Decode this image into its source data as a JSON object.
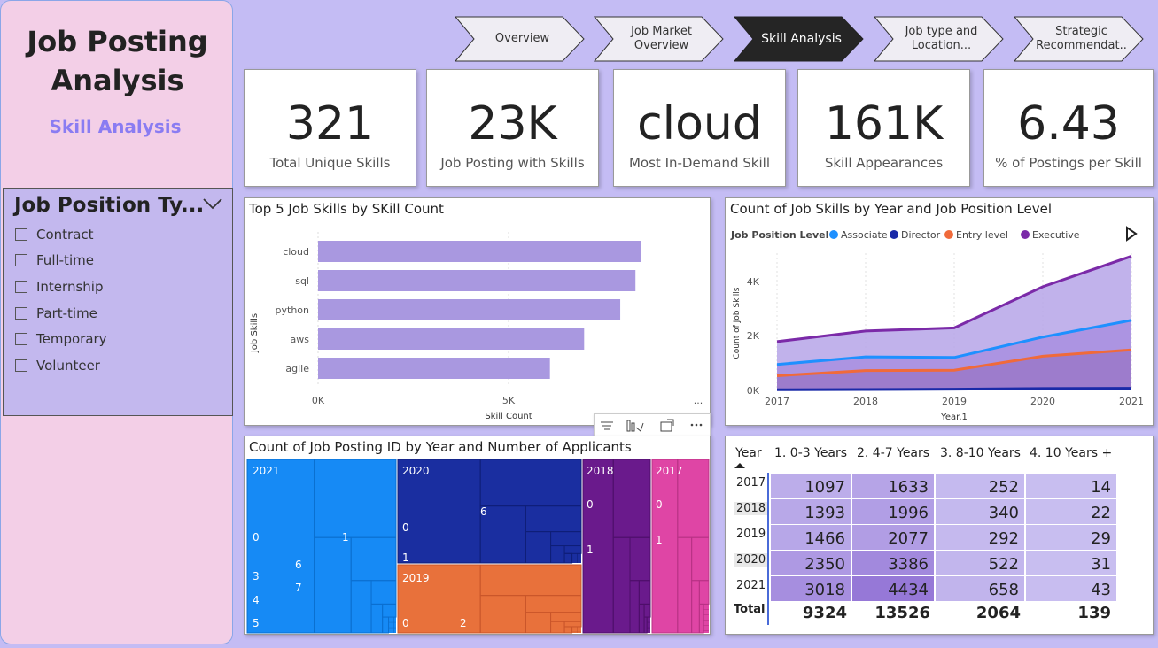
{
  "sidebar": {
    "title": "Job Posting Analysis",
    "subtitle": "Skill Analysis"
  },
  "slicer": {
    "title": "Job Position Ty...",
    "items": [
      "Contract",
      "Full-time",
      "Internship",
      "Part-time",
      "Temporary",
      "Volunteer"
    ]
  },
  "nav": {
    "tabs": [
      {
        "label": "Overview"
      },
      {
        "label": "Job Market Overview"
      },
      {
        "label": "Skill Analysis"
      },
      {
        "label": "Job type and Location..."
      },
      {
        "label": "Strategic Recommendat.."
      }
    ],
    "active": "Skill Analysis"
  },
  "kpis": [
    {
      "value": "321",
      "label": "Total Unique Skills"
    },
    {
      "value": "23K",
      "label": "Job Posting with Skills"
    },
    {
      "value": "cloud",
      "label": "Most In-Demand Skill"
    },
    {
      "value": "161K",
      "label": "Skill Appearances"
    },
    {
      "value": "6.43",
      "label": "% of Postings per Skill"
    }
  ],
  "bar_chart": {
    "title": "Top 5 Job Skills by SKill Count",
    "xlabel": "Skill Count",
    "ylabel": "Job Skills",
    "xticks": [
      "0K",
      "5K"
    ],
    "more": "..."
  },
  "area_chart": {
    "title": "Count of Job Skills by Year and Job Position Level",
    "legend_title": "Job Position Level",
    "xlabel": "Year.1",
    "ylabel": "Count of Job Skills",
    "yticks": [
      "0K",
      "2K",
      "4K"
    ]
  },
  "treemap": {
    "title": "Count of Job Posting ID by Year and Number of Applicants",
    "labels": {
      "y2021": "2021",
      "y2020": "2020",
      "y2019": "2019",
      "y2018": "2018",
      "y2017": "2017",
      "a0": "0",
      "a1": "1",
      "a2": "2",
      "a3": "3",
      "a4": "4",
      "a5": "5",
      "a6": "6",
      "a7": "7"
    }
  },
  "table": {
    "headers": [
      "Year",
      "1. 0-3 Years",
      "2. 4-7 Years",
      "3. 8-10 Years",
      "4. 10 Years +"
    ],
    "rows": [
      {
        "year": "2017",
        "v": [
          "1097",
          "1633",
          "252",
          "14"
        ]
      },
      {
        "year": "2018",
        "v": [
          "1393",
          "1996",
          "340",
          "22"
        ]
      },
      {
        "year": "2019",
        "v": [
          "1466",
          "2077",
          "292",
          "29"
        ]
      },
      {
        "year": "2020",
        "v": [
          "2350",
          "3386",
          "522",
          "31"
        ]
      },
      {
        "year": "2021",
        "v": [
          "3018",
          "4434",
          "658",
          "43"
        ]
      }
    ],
    "total_label": "Total",
    "totals": [
      "9324",
      "13526",
      "2064",
      "139"
    ]
  },
  "chart_data": [
    {
      "type": "bar",
      "title": "Top 5 Job Skills by SKill Count",
      "categories": [
        "cloud",
        "sql",
        "python",
        "aws",
        "agile"
      ],
      "values": [
        8500,
        8350,
        7950,
        7000,
        6100
      ],
      "xlabel": "Skill Count",
      "ylabel": "Job Skills",
      "xlim": [
        0,
        10000
      ],
      "color": "#a998e0"
    },
    {
      "type": "area",
      "title": "Count of Job Skills by Year and Job Position Level",
      "x": [
        2017,
        2018,
        2019,
        2020,
        2021
      ],
      "xlabel": "Year.1",
      "ylabel": "Count of Job Skills",
      "ylim": [
        0,
        4500
      ],
      "legend_position": "top-left",
      "series": [
        {
          "name": "Associate",
          "color": "#1e90ff",
          "values": [
            850,
            1100,
            1080,
            1750,
            2300
          ]
        },
        {
          "name": "Director",
          "color": "#1a2aa8",
          "values": [
            20,
            30,
            40,
            60,
            70
          ]
        },
        {
          "name": "Entry level",
          "color": "#f06a3a",
          "values": [
            480,
            650,
            660,
            1120,
            1330
          ]
        },
        {
          "name": "Executive",
          "color": "#7b2aa8",
          "values": [
            1600,
            1950,
            2050,
            3400,
            4400
          ]
        }
      ]
    },
    {
      "type": "table",
      "columns": [
        "1. 0-3 Years",
        "2. 4-7 Years",
        "3. 8-10 Years",
        "4. 10 Years +"
      ],
      "rows": [
        "2017",
        "2018",
        "2019",
        "2020",
        "2021"
      ],
      "values": [
        [
          1097,
          1633,
          252,
          14
        ],
        [
          1393,
          1996,
          340,
          22
        ],
        [
          1466,
          2077,
          292,
          29
        ],
        [
          2350,
          3386,
          522,
          31
        ],
        [
          3018,
          4434,
          658,
          43
        ]
      ],
      "totals": [
        9324,
        13526,
        2064,
        139
      ]
    }
  ]
}
